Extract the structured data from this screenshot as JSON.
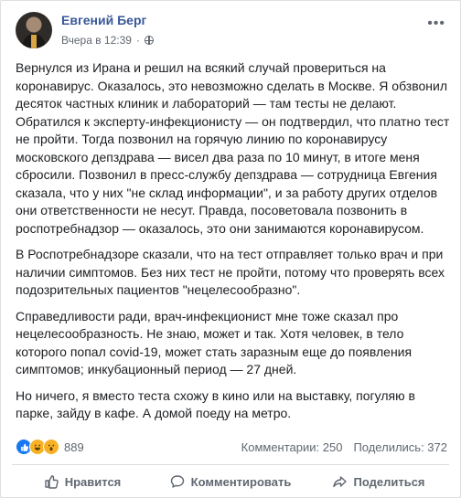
{
  "post": {
    "author": "Евгений Берг",
    "timestamp": "Вчера в 12:39",
    "privacy_separator": "·",
    "more_label": "•••",
    "paragraphs": [
      "Вернулся из Ирана и решил на всякий случай провериться на коронавирус. Оказалось, это невозможно сделать в Москве. Я обзвонил десяток частных клиник и лабораторий — там тесты не делают. Обратился к эксперту-инфекционисту — он подтвердил, что платно тест не пройти. Тогда позвонил на горячую линию по коронавирусу московского депздрава — висел два раза по 10 минут, в итоге меня сбросили. Позвонил в пресс-службу депздрава — сотрудница Евгения сказала, что у них \"не склад информации\", и за работу других отделов они ответственности не несут. Правда, посоветовала позвонить в роспотребнадзор — оказалось, это они занимаются коронавирусом.",
      "В Роспотребнадзоре сказали, что на тест отправляет только врач и при наличии симптомов. Без них тест не пройти, потому что проверять всех подозрительных пациентов \"нецелесообразно\".",
      "Справедливости ради, врач-инфекционист мне тоже сказал про нецелесообразность. Не знаю, может и так. Хотя человек, в тело которого попал covid-19, может стать заразным еще до появления симптомов; инкубационный период — 27 дней.",
      "Но ничего, я вместо теста схожу в кино или на выставку, погуляю в парке, зайду в кафе. А домой поеду на метро."
    ]
  },
  "stats": {
    "reaction_count": "889",
    "comments": "Комментарии: 250",
    "shares": "Поделились: 372",
    "reaction_icons": [
      "like-icon",
      "haha-icon",
      "wow-icon"
    ]
  },
  "actions": {
    "like": "Нравится",
    "comment": "Комментировать",
    "share": "Поделиться"
  },
  "colors": {
    "author_link": "#385898",
    "like_blue": "#1877f2",
    "reaction_yellow": "#f7b125",
    "muted_text": "#606770"
  }
}
